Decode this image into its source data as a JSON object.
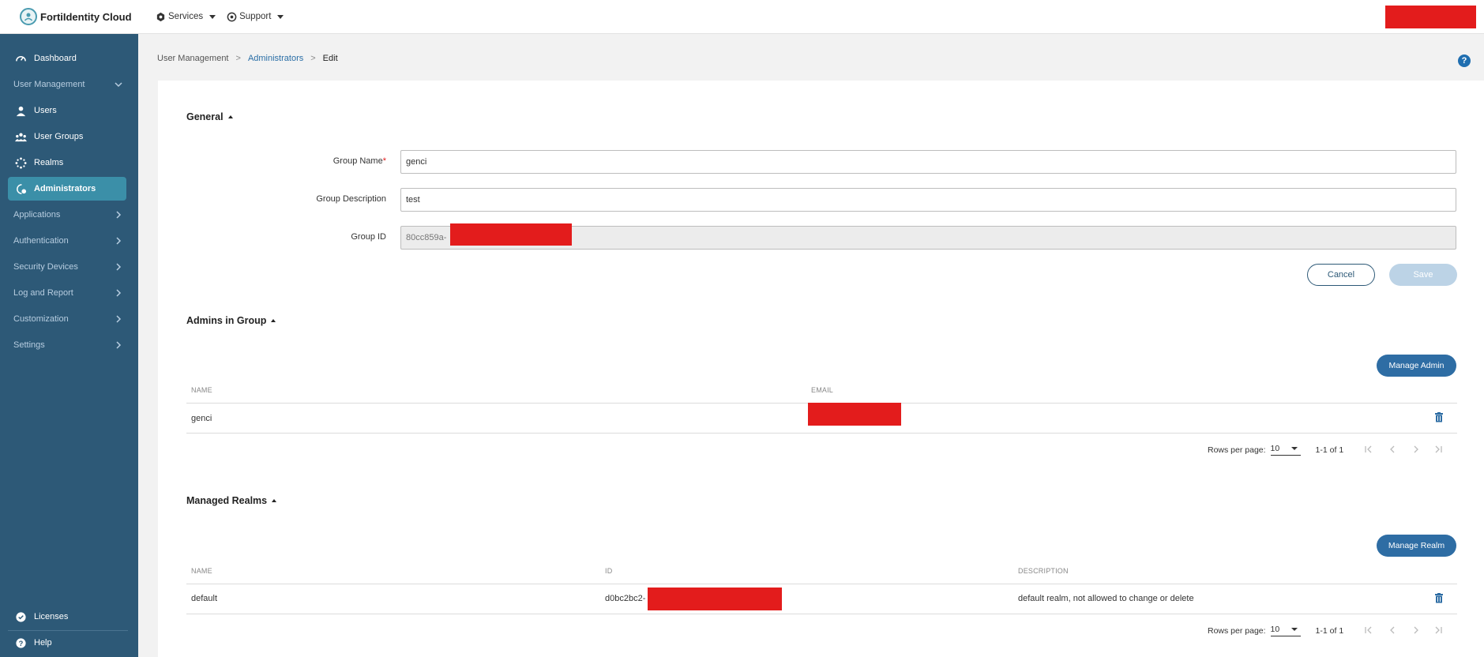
{
  "app": {
    "name": "FortiIdentity Cloud",
    "top_menu": [
      {
        "label": "Services",
        "icon": "services-icon"
      },
      {
        "label": "Support",
        "icon": "support-icon"
      }
    ]
  },
  "sidebar": {
    "dashboard": "Dashboard",
    "user_management": "User Management",
    "users": "Users",
    "user_groups": "User Groups",
    "realms": "Realms",
    "administrators": "Administrators",
    "applications": "Applications",
    "authentication": "Authentication",
    "security_devices": "Security Devices",
    "log_and_report": "Log and Report",
    "customization": "Customization",
    "settings": "Settings",
    "licenses": "Licenses",
    "help": "Help"
  },
  "breadcrumb": {
    "root": "User Management",
    "parent": "Administrators",
    "current": "Edit",
    "sep": ">"
  },
  "help_icon": "?",
  "general": {
    "title": "General",
    "group_name_label": "Group Name",
    "required_mark": "*",
    "group_name_value": "genci",
    "group_description_label": "Group Description",
    "group_description_value": "test",
    "group_id_label": "Group ID",
    "group_id_value": "80cc859a-",
    "cancel": "Cancel",
    "save": "Save"
  },
  "admins": {
    "title": "Admins in Group",
    "manage_button": "Manage Admin",
    "columns": [
      "NAME",
      "EMAIL"
    ],
    "rows": [
      {
        "name": "genci",
        "email": ""
      }
    ],
    "rows_per_page_label": "Rows per page:",
    "rows_per_page": "10",
    "range": "1-1 of 1"
  },
  "realms": {
    "title": "Managed Realms",
    "manage_button": "Manage Realm",
    "columns": [
      "NAME",
      "ID",
      "DESCRIPTION"
    ],
    "rows": [
      {
        "name": "default",
        "id": "d0bc2bc2-",
        "description": "default realm, not allowed to change or delete"
      }
    ],
    "rows_per_page_label": "Rows per page:",
    "rows_per_page": "10",
    "range": "1-1 of 1"
  },
  "colors": {
    "sidebar_bg": "#2d5977",
    "active_item": "#3b8fa8",
    "primary": "#2e6da4",
    "redaction": "#e31c1c"
  }
}
